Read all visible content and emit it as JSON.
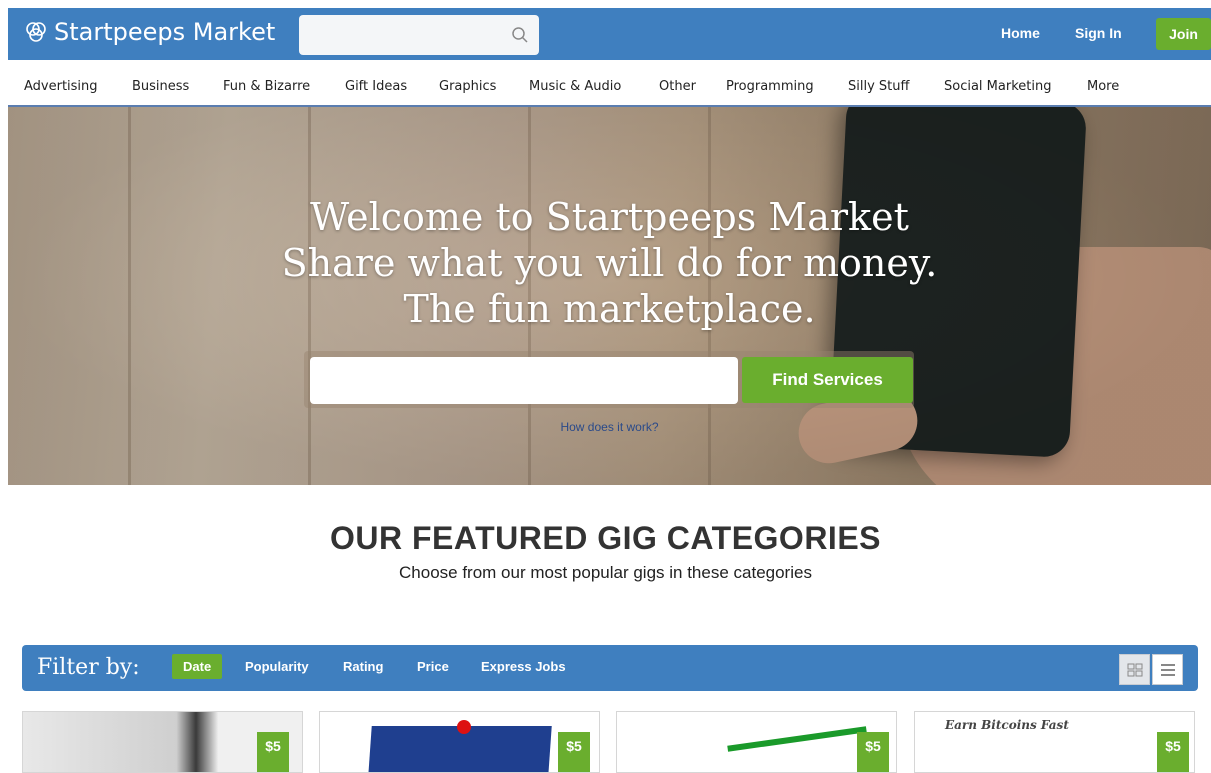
{
  "header": {
    "logo_text": "Startpeeps Market",
    "search_placeholder": "",
    "nav": {
      "home": "Home",
      "sign_in": "Sign In",
      "join": "Join"
    }
  },
  "categories": [
    "Advertising",
    "Business",
    "Fun & Bizarre",
    "Gift Ideas",
    "Graphics",
    "Music & Audio",
    "Other",
    "Programming",
    "Silly Stuff",
    "Social Marketing",
    "More"
  ],
  "hero": {
    "line1": "Welcome to Startpeeps Market",
    "line2": "Share what you will do for money.",
    "line3": "The fun marketplace.",
    "search_placeholder": "",
    "find_button": "Find Services",
    "how_link": "How does it work?"
  },
  "featured": {
    "title": "OUR FEATURED GIG CATEGORIES",
    "subtitle": "Choose from our most popular gigs in these categories"
  },
  "filter": {
    "label": "Filter by:",
    "options": [
      "Date",
      "Popularity",
      "Rating",
      "Price",
      "Express Jobs"
    ],
    "active": "Date"
  },
  "cards": [
    {
      "price": "$5"
    },
    {
      "price": "$5"
    },
    {
      "price": "$5"
    },
    {
      "price": "$5",
      "image_caption": "Earn Bitcoins Fast"
    }
  ],
  "colors": {
    "brand_blue": "#3f7fbf",
    "accent_green": "#6aae2e"
  }
}
